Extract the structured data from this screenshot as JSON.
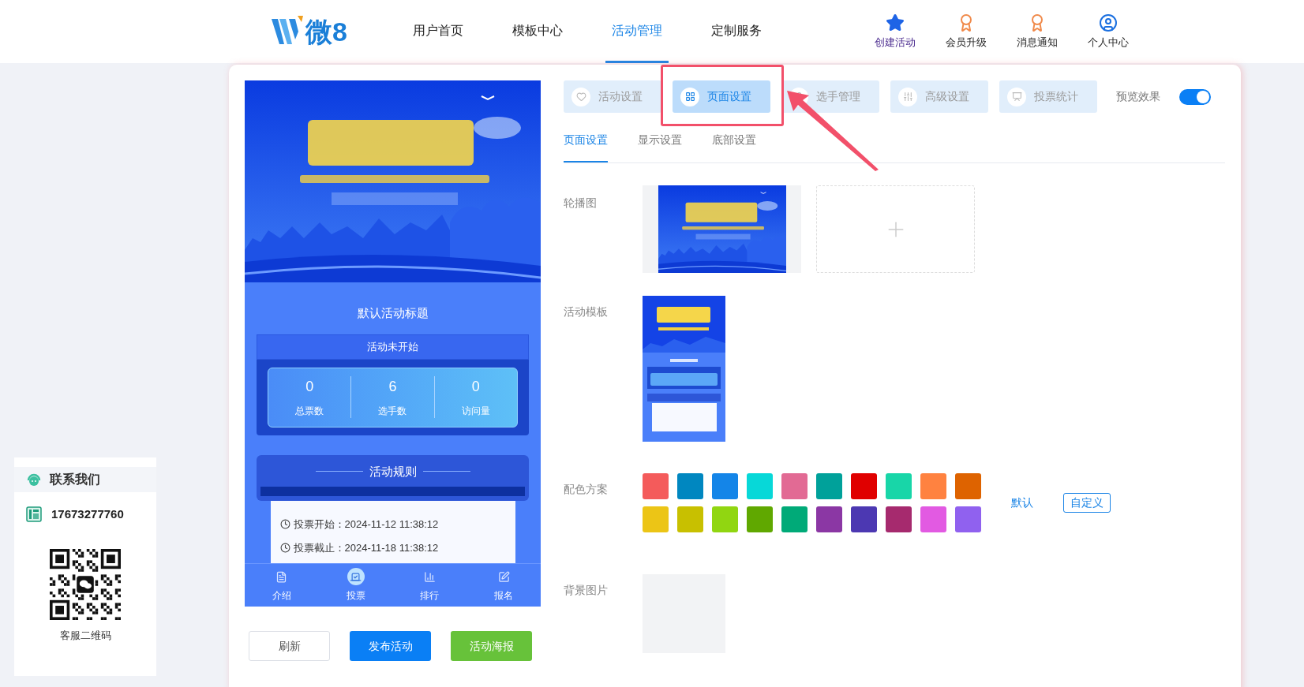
{
  "header": {
    "logo_text": "微8",
    "nav": [
      {
        "label": "用户首页",
        "selected": false
      },
      {
        "label": "模板中心",
        "selected": false
      },
      {
        "label": "活动管理",
        "selected": true
      },
      {
        "label": "定制服务",
        "selected": false
      }
    ],
    "actions": [
      {
        "kind": "star",
        "label": "创建活动"
      },
      {
        "kind": "badge",
        "label": "会员升级"
      },
      {
        "kind": "badge",
        "label": "消息通知"
      },
      {
        "kind": "user",
        "label": "个人中心"
      }
    ]
  },
  "contact": {
    "title": "联系我们",
    "phone": "17673277760",
    "qr_caption": "客服二维码"
  },
  "preview": {
    "title": "默认活动标题",
    "status": "活动未开始",
    "stats": [
      {
        "value": "0",
        "label": "总票数"
      },
      {
        "value": "6",
        "label": "选手数"
      },
      {
        "value": "0",
        "label": "访问量"
      }
    ],
    "rules_title": "活动规则",
    "rules": [
      "投票开始：2024-11-12 11:38:12",
      "投票截止：2024-11-18 11:38:12"
    ],
    "bottom_nav": [
      {
        "kind": "doc",
        "label": "介绍",
        "selected": false
      },
      {
        "kind": "vote",
        "label": "投票",
        "selected": true
      },
      {
        "kind": "chart",
        "label": "排行",
        "selected": false
      },
      {
        "kind": "edit",
        "label": "报名",
        "selected": false
      }
    ]
  },
  "preview_buttons": [
    {
      "kind": "plain",
      "label": "刷新"
    },
    {
      "kind": "primary",
      "label": "发布活动"
    },
    {
      "kind": "success",
      "label": "活动海报"
    }
  ],
  "settings_tabs": [
    {
      "kind": "heart",
      "label": "活动设置",
      "selected": false
    },
    {
      "kind": "grid",
      "label": "页面设置",
      "selected": true
    },
    {
      "kind": "user",
      "label": "选手管理",
      "selected": false
    },
    {
      "kind": "sliders",
      "label": "高级设置",
      "selected": false
    },
    {
      "kind": "chart",
      "label": "投票统计",
      "selected": false
    }
  ],
  "preview_toggle": {
    "label": "预览效果",
    "on": true
  },
  "subtabs": [
    {
      "label": "页面设置",
      "selected": true
    },
    {
      "label": "显示设置",
      "selected": false
    },
    {
      "label": "底部设置",
      "selected": false
    }
  ],
  "form": {
    "carousel_label": "轮播图",
    "template_label": "活动模板",
    "color_label": "配色方案",
    "colors": [
      {
        "color": "#f45b5b"
      },
      {
        "color": "#0087c0"
      },
      {
        "color": "#1485e8"
      },
      {
        "color": "#07d8d8"
      },
      {
        "color": "#e26a94"
      },
      {
        "color": "#00a19a"
      },
      {
        "color": "#e00000"
      },
      {
        "color": "#18d6a8"
      },
      {
        "color": "#ff8240"
      },
      {
        "color": "#de6300"
      },
      {
        "color": "#ecc516"
      },
      {
        "color": "#c8c000"
      },
      {
        "color": "#91d611"
      },
      {
        "color": "#60a800"
      },
      {
        "color": "#00aa78"
      },
      {
        "color": "#8b37a4"
      },
      {
        "color": "#4c38b2"
      },
      {
        "color": "#a62a6e"
      },
      {
        "color": "#e25ae2"
      },
      {
        "color": "#9061ef"
      }
    ],
    "default_link": "默认",
    "custom_button": "自定义",
    "background_label": "背景图片"
  }
}
